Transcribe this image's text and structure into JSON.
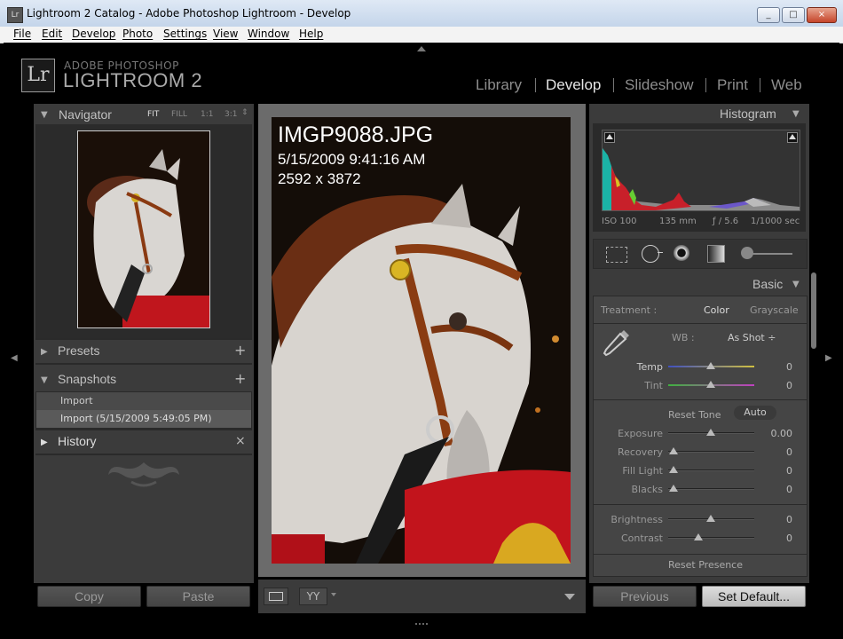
{
  "window": {
    "title": "Lightroom 2 Catalog - Adobe Photoshop Lightroom - Develop",
    "app_icon": "Lr",
    "controls": {
      "minimize": "_",
      "maximize": "□",
      "close": "×"
    }
  },
  "menu": {
    "items": [
      "File",
      "Edit",
      "Develop",
      "Photo",
      "Settings",
      "View",
      "Window",
      "Help"
    ]
  },
  "brand": {
    "logo": "Lr",
    "line1": "ADOBE PHOTOSHOP",
    "line2": "LIGHTROOM 2"
  },
  "modules": {
    "items": [
      "Library",
      "Develop",
      "Slideshow",
      "Print",
      "Web"
    ],
    "active": "Develop"
  },
  "navigator": {
    "title": "Navigator",
    "zoom_options": [
      "FIT",
      "FILL",
      "1:1",
      "3:1"
    ],
    "zoom_selected": "FIT"
  },
  "presets": {
    "title": "Presets",
    "add": "+"
  },
  "snapshots": {
    "title": "Snapshots",
    "add": "+",
    "items": [
      "Import",
      "Import (5/15/2009 5:49:05 PM)"
    ]
  },
  "history": {
    "title": "History",
    "clear": "×"
  },
  "left_buttons": {
    "copy": "Copy",
    "paste": "Paste"
  },
  "photo_info": {
    "filename": "IMGP9088.JPG",
    "datetime": "5/15/2009 9:41:16 AM",
    "dimensions": "2592 x 3872"
  },
  "histogram": {
    "title": "Histogram",
    "iso": "ISO 100",
    "focal": "135 mm",
    "aperture": "ƒ / 5.6",
    "shutter": "1/1000 sec"
  },
  "tools": {
    "items": [
      "crop-overlay-icon",
      "spot-removal-icon",
      "red-eye-icon",
      "graduated-filter-icon",
      "adjustment-brush-icon"
    ]
  },
  "basic": {
    "title": "Basic",
    "treatment_label": "Treatment :",
    "treatment_options": [
      "Color",
      "Grayscale"
    ],
    "treatment_selected": "Color",
    "wb_label": "WB :",
    "wb_value": "As Shot ÷",
    "reset_tone": "Reset Tone",
    "auto": "Auto",
    "reset_presence": "Reset Presence",
    "sliders": {
      "temp": {
        "label": "Temp",
        "value": "0",
        "pos": 0.5
      },
      "tint": {
        "label": "Tint",
        "value": "0",
        "pos": 0.5
      },
      "exposure": {
        "label": "Exposure",
        "value": "0.00",
        "pos": 0.5
      },
      "recovery": {
        "label": "Recovery",
        "value": "0",
        "pos": 0.0
      },
      "fill_light": {
        "label": "Fill Light",
        "value": "0",
        "pos": 0.0
      },
      "blacks": {
        "label": "Blacks",
        "value": "0",
        "pos": 0.0
      },
      "brightness": {
        "label": "Brightness",
        "value": "0",
        "pos": 0.5
      },
      "contrast": {
        "label": "Contrast",
        "value": "0",
        "pos": 0.3
      }
    }
  },
  "right_buttons": {
    "previous": "Previous",
    "set_default": "Set Default..."
  },
  "toolbar": {
    "view_mode": "YY"
  },
  "colors": {
    "accent": "#e6e6e6",
    "panel": "#3b3b3b",
    "background": "#000000"
  }
}
